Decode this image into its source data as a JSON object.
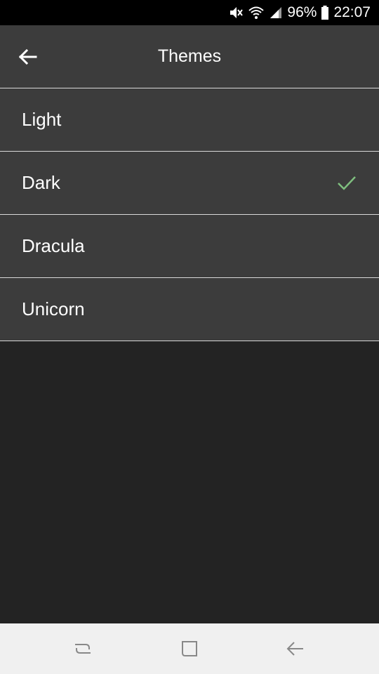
{
  "status_bar": {
    "battery_percent": "96%",
    "time": "22:07",
    "icons": [
      "mute-icon",
      "wifi-icon",
      "signal-icon",
      "battery-icon"
    ]
  },
  "toolbar": {
    "title": "Themes",
    "back_icon": "arrow-left-icon"
  },
  "themes": [
    {
      "label": "Light",
      "selected": false
    },
    {
      "label": "Dark",
      "selected": true
    },
    {
      "label": "Dracula",
      "selected": false
    },
    {
      "label": "Unicorn",
      "selected": false
    }
  ],
  "navigation_bar": {
    "buttons": [
      "recent-apps-icon",
      "home-icon",
      "back-icon"
    ]
  },
  "colors": {
    "status_bar_bg": "#000000",
    "toolbar_bg": "#3c3c3c",
    "list_item_bg": "#3c3c3c",
    "page_bg": "#232323",
    "divider": "#d9d9d9",
    "check_accent": "#7fbf7f",
    "nav_bar_bg": "#f0f0f0",
    "text": "#ffffff"
  }
}
